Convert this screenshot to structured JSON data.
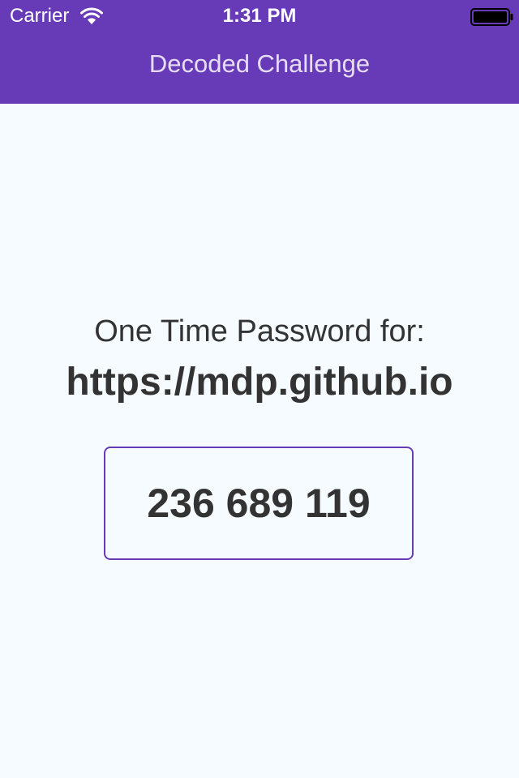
{
  "status_bar": {
    "carrier": "Carrier",
    "time": "1:31 PM",
    "wifi_icon": "wifi-icon",
    "battery_icon": "battery-full-icon"
  },
  "nav": {
    "title": "Decoded Challenge"
  },
  "otp": {
    "label": "One Time Password for:",
    "site": "https://mdp.github.io",
    "code": "236 689 119"
  },
  "colors": {
    "header_background": "#673ab7",
    "page_background": "#f5fbfe",
    "text": "#333333",
    "code_border": "#673ab7"
  }
}
